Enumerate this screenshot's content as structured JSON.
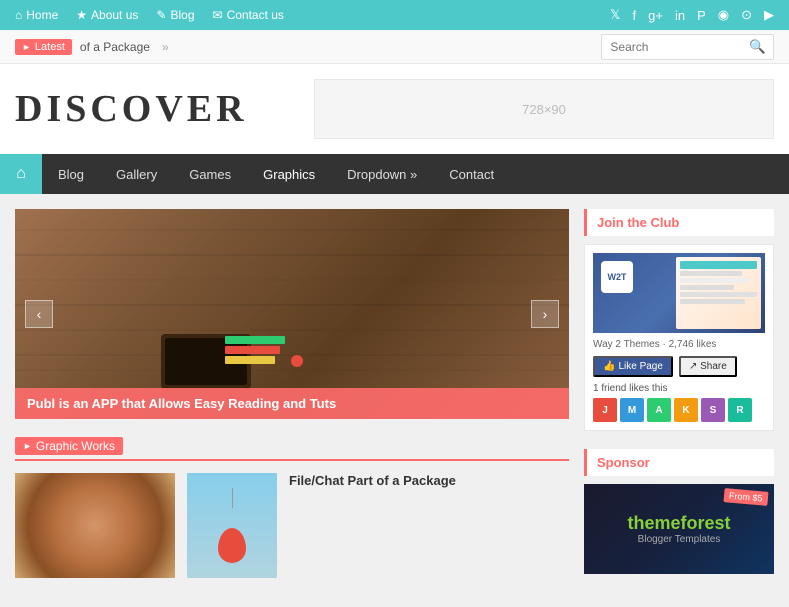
{
  "topbar": {
    "nav_items": [
      {
        "label": "Home",
        "icon": "home"
      },
      {
        "label": "About us",
        "icon": "star"
      },
      {
        "label": "Blog",
        "icon": "pencil"
      },
      {
        "label": "Contact us",
        "icon": "envelope"
      }
    ],
    "social_icons": [
      "twitter",
      "facebook",
      "google-plus",
      "linkedin",
      "pinterest",
      "instagram",
      "dribbble",
      "youtube"
    ]
  },
  "latestbar": {
    "badge_label": "Latest",
    "headline": "of a Package",
    "arrow": "»",
    "search_placeholder": "Search"
  },
  "header": {
    "logo": "DISCOVER",
    "ad_label": "728×90"
  },
  "nav": {
    "home_icon": "⌂",
    "items": [
      {
        "label": "Blog"
      },
      {
        "label": "Gallery"
      },
      {
        "label": "Games"
      },
      {
        "label": "Graphics"
      },
      {
        "label": "Dropdown »"
      },
      {
        "label": "Contact"
      }
    ]
  },
  "slider": {
    "caption": "Publ is an APP that Allows Easy Reading and Tuts",
    "prev": "‹",
    "next": "›"
  },
  "graphic_works": {
    "section_label": "Graphic Works",
    "posts": [
      {
        "title": "File/Chat Part of a Package",
        "thumb_type": "balloon"
      }
    ]
  },
  "sidebar": {
    "join_club": {
      "title": "Join the Club",
      "page_name": "Way 2 Themes",
      "likes_count": "2,746 likes",
      "like_btn": "Like Page",
      "share_btn": "Share",
      "friend_text": "1 friend likes this",
      "logo_text": "W2T"
    },
    "sponsor": {
      "title": "Sponsor",
      "brand": "themeforest",
      "sub": "Blogger Templates",
      "badge": "From $5"
    }
  }
}
